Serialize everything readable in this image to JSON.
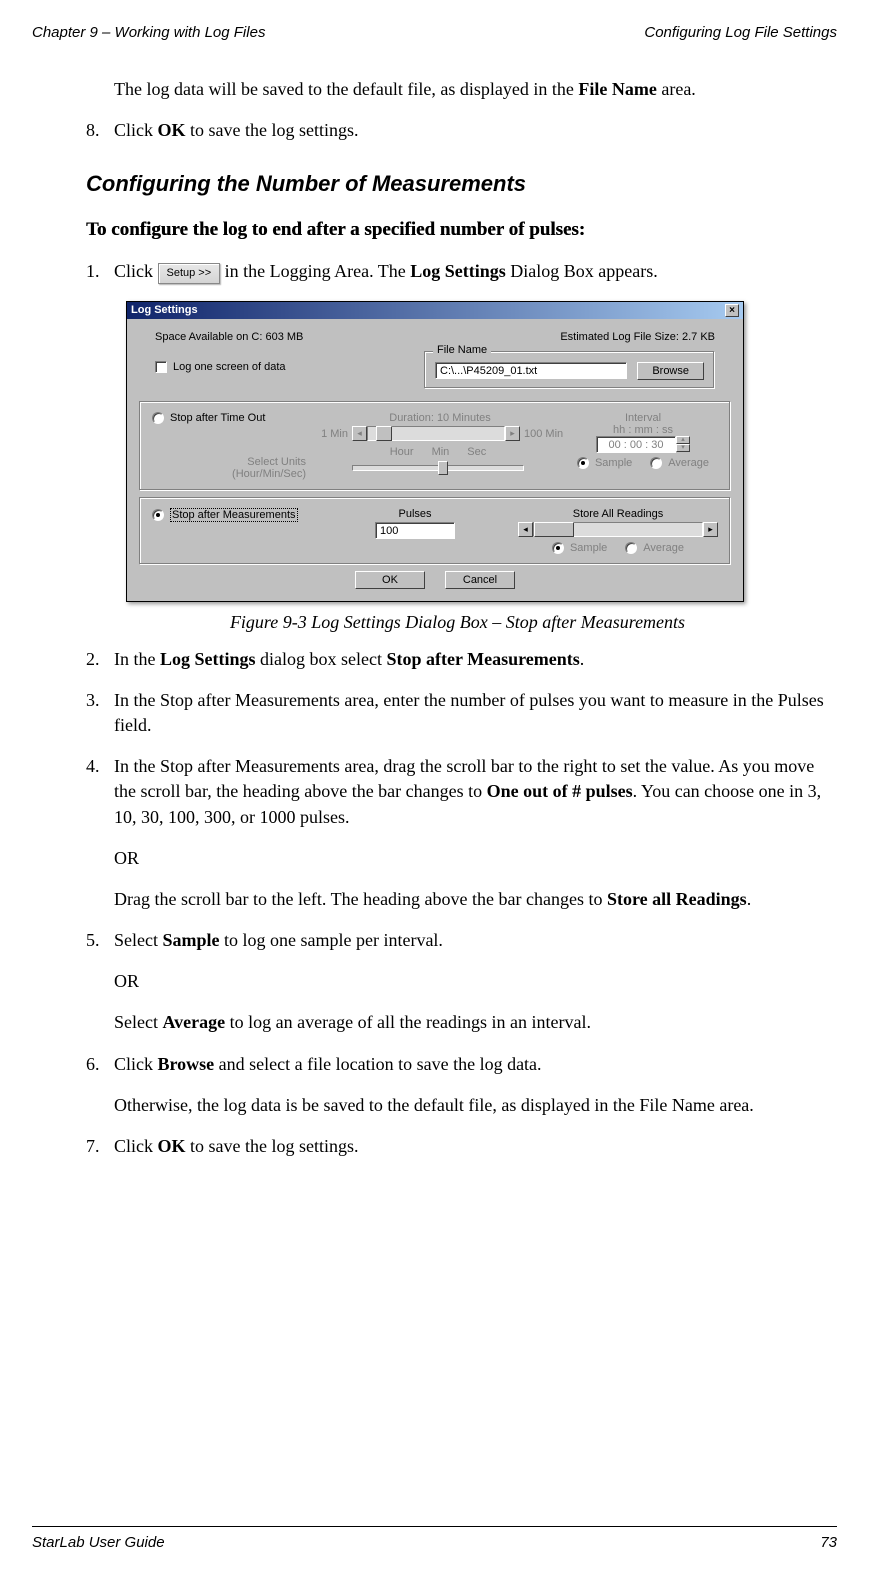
{
  "header": {
    "left": "Chapter 9 – Working with Log Files",
    "right": "Configuring Log File Settings"
  },
  "intro": {
    "text_before": "The log data will be saved to the default file, as displayed in the ",
    "bold1": "File Name",
    "text_after": " area."
  },
  "step8": {
    "num": "8.",
    "pre": "Click ",
    "bold": "OK",
    "post": " to save the log settings."
  },
  "section_title": "Configuring the Number of Measurements",
  "sub_title": "To configure the log to end after a specified number of pulses:",
  "step1": {
    "num": "1.",
    "pre": "Click ",
    "btn_label": "Setup >>",
    "mid": " in the Logging Area. The ",
    "bold": "Log Settings",
    "post": " Dialog Box appears."
  },
  "dlg": {
    "title": "Log Settings",
    "space": "Space Available on C: 603 MB",
    "est": "Estimated Log File Size: 2.7 KB",
    "log_one": "Log one screen of data",
    "file_name_legend": "File Name",
    "file_path": "C:\\...\\P45209_01.txt",
    "browse": "Browse",
    "stop_timeout": "Stop after Time Out",
    "duration": "Duration: 10 Minutes",
    "min1": "1 Min",
    "min100": "100 Min",
    "units_label": "Select Units (Hour/Min/Sec)",
    "hour": "Hour",
    "min": "Min",
    "sec": "Sec",
    "interval": "Interval",
    "hhmmss": "hh : mm : ss",
    "interval_val": "00 : 00 : 30",
    "sample": "Sample",
    "average": "Average",
    "stop_meas": "Stop after Measurements",
    "pulses": "Pulses",
    "pulses_val": "100",
    "store_all": "Store All Readings",
    "ok": "OK",
    "cancel": "Cancel"
  },
  "caption": "Figure 9-3 Log Settings Dialog Box – Stop after Measurements",
  "step2": {
    "num": "2.",
    "pre": "In the ",
    "b1": "Log Settings",
    "mid": " dialog box select ",
    "b2": "Stop after Measurements",
    "post": "."
  },
  "step3": {
    "num": "3.",
    "text": "In the Stop after Measurements area, enter the number of pulses you want to measure in the Pulses field."
  },
  "step4": {
    "num": "4.",
    "p1a": "In the Stop after Measurements area, drag the scroll bar to the right to set the value. As you move the scroll bar, the heading above the bar changes to ",
    "p1b": "One out of # pulses",
    "p1c": ". You can choose one in 3, 10, 30, 100, 300, or 1000 pulses.",
    "or": "OR",
    "p2a": "Drag the scroll bar to the left. The heading above the bar changes to ",
    "p2b": "Store all Readings",
    "p2c": "."
  },
  "step5": {
    "num": "5.",
    "p1a": "Select ",
    "p1b": "Sample",
    "p1c": " to log one sample per interval.",
    "or": "OR",
    "p2a": "Select ",
    "p2b": "Average",
    "p2c": " to log an average of all the readings in an interval."
  },
  "step6": {
    "num": "6.",
    "p1a": "Click ",
    "p1b": "Browse",
    "p1c": " and select a file location to save the log data.",
    "p2": "Otherwise, the log data is be saved to the default file, as displayed in the File Name area."
  },
  "step7": {
    "num": "7.",
    "pre": "Click ",
    "bold": "OK",
    "post": " to save the log settings."
  },
  "footer": {
    "left": "StarLab User Guide",
    "right": "73"
  }
}
